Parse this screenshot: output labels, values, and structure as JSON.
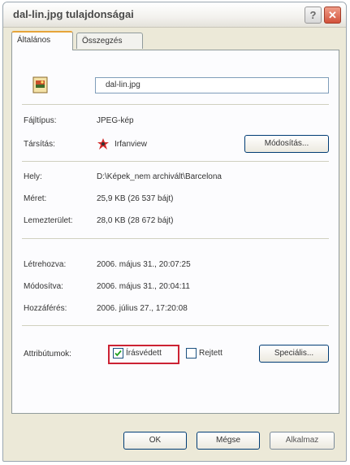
{
  "window": {
    "title": "dal-lin.jpg tulajdonságai",
    "help_label": "?",
    "close_label": "✕"
  },
  "tabs": [
    {
      "label": "Általános",
      "active": true
    },
    {
      "label": "Összegzés",
      "active": false
    }
  ],
  "file": {
    "name_value": "dal-lin.jpg",
    "icon": "jpeg-file-icon"
  },
  "properties": {
    "type_label": "Fájltípus:",
    "type_value": "JPEG-kép",
    "opens_label": "Társítás:",
    "opens_value": "Irfanview",
    "opens_icon": "irfanview-icon",
    "change_button": "Módosítás...",
    "location_label": "Hely:",
    "location_value": "D:\\Képek_nem archivált\\Barcelona",
    "size_label": "Méret:",
    "size_value": "25,9 KB (26 537 bájt)",
    "disk_size_label": "Lemezterület:",
    "disk_size_value": "28,0 KB (28 672 bájt)",
    "created_label": "Létrehozva:",
    "created_value": "2006. május 31., 20:07:25",
    "modified_label": "Módosítva:",
    "modified_value": "2006. május 31., 20:04:11",
    "accessed_label": "Hozzáférés:",
    "accessed_value": "2006. július 27., 17:20:08"
  },
  "attributes": {
    "label": "Attribútumok:",
    "readonly_label": "Írásvédett",
    "readonly_checked": true,
    "hidden_label": "Rejtett",
    "hidden_checked": false,
    "special_button": "Speciális..."
  },
  "footer": {
    "ok_button": "OK",
    "cancel_button": "Mégse",
    "apply_button": "Alkalmaz"
  },
  "colors": {
    "highlight": "#cc2233",
    "tab_accent": "#e6a43a",
    "button_border": "#003c74"
  }
}
